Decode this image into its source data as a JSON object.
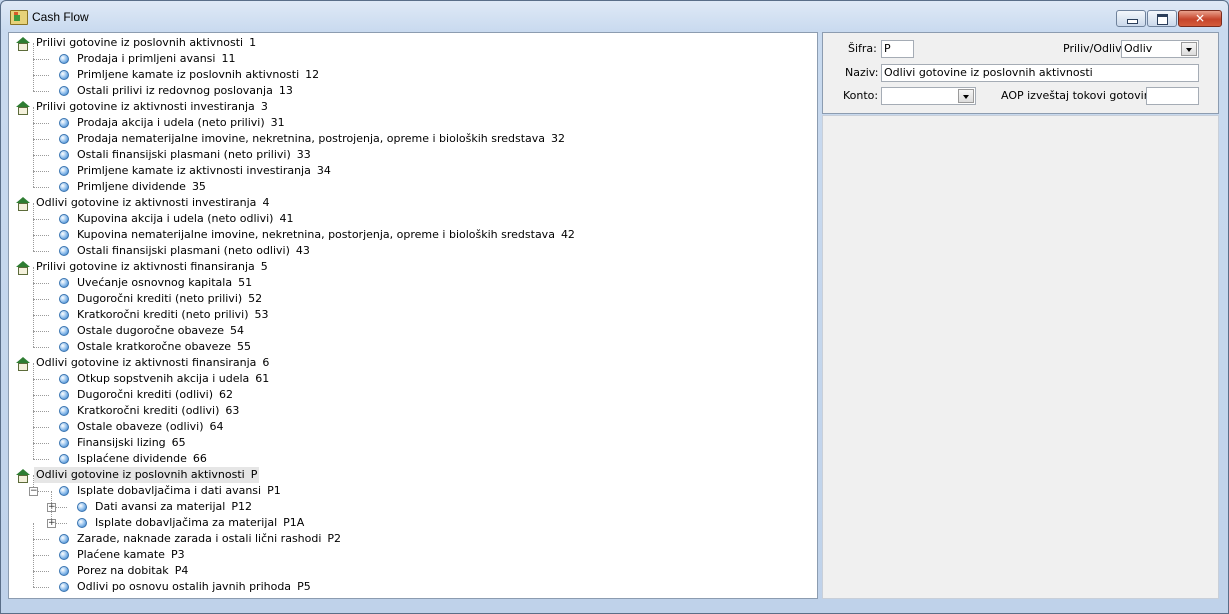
{
  "window": {
    "title": "Cash Flow",
    "controls": {
      "minimize": "minimize",
      "maximize": "maximize",
      "close": "✕"
    }
  },
  "tree": [
    {
      "label": "Prilivi gotovine iz poslovnih aktivnosti",
      "code": "1",
      "level": 0,
      "type": "group"
    },
    {
      "label": "Prodaja i primljeni avansi",
      "code": "11",
      "level": 1,
      "type": "item"
    },
    {
      "label": "Primljene kamate iz poslovnih aktivnosti",
      "code": "12",
      "level": 1,
      "type": "item"
    },
    {
      "label": "Ostali prilivi iz redovnog poslovanja",
      "code": "13",
      "level": 1,
      "type": "item"
    },
    {
      "label": "Prilivi gotovine iz aktivnosti investiranja",
      "code": "3",
      "level": 0,
      "type": "group"
    },
    {
      "label": "Prodaja akcija i udela (neto prilivi)",
      "code": "31",
      "level": 1,
      "type": "item"
    },
    {
      "label": "Prodaja nematerijalne imovine, nekretnina, postrojenja, opreme i bioloških sredstava",
      "code": "32",
      "level": 1,
      "type": "item"
    },
    {
      "label": "Ostali finansijski plasmani (neto prilivi)",
      "code": "33",
      "level": 1,
      "type": "item"
    },
    {
      "label": "Primljene kamate iz aktivnosti investiranja",
      "code": "34",
      "level": 1,
      "type": "item"
    },
    {
      "label": "Primljene dividende",
      "code": "35",
      "level": 1,
      "type": "item"
    },
    {
      "label": "Odlivi gotovine iz aktivnosti investiranja",
      "code": "4",
      "level": 0,
      "type": "group"
    },
    {
      "label": "Kupovina akcija i udela (neto odlivi)",
      "code": "41",
      "level": 1,
      "type": "item"
    },
    {
      "label": "Kupovina nematerijalne imovine, nekretnina, postorjenja, opreme i bioloških sredstava",
      "code": "42",
      "level": 1,
      "type": "item"
    },
    {
      "label": "Ostali finansijski plasmani (neto odlivi)",
      "code": "43",
      "level": 1,
      "type": "item"
    },
    {
      "label": "Prilivi gotovine iz aktivnosti finansiranja",
      "code": "5",
      "level": 0,
      "type": "group"
    },
    {
      "label": "Uvećanje osnovnog kapitala",
      "code": "51",
      "level": 1,
      "type": "item"
    },
    {
      "label": "Dugoročni krediti (neto prilivi)",
      "code": "52",
      "level": 1,
      "type": "item"
    },
    {
      "label": "Kratkoročni krediti (neto prilivi)",
      "code": "53",
      "level": 1,
      "type": "item"
    },
    {
      "label": "Ostale dugoročne obaveze",
      "code": "54",
      "level": 1,
      "type": "item"
    },
    {
      "label": "Ostale kratkoročne obaveze",
      "code": "55",
      "level": 1,
      "type": "item"
    },
    {
      "label": "Odlivi gotovine iz aktivnosti finansiranja",
      "code": "6",
      "level": 0,
      "type": "group"
    },
    {
      "label": "Otkup sopstvenih akcija i udela",
      "code": "61",
      "level": 1,
      "type": "item"
    },
    {
      "label": "Dugoročni krediti (odlivi)",
      "code": "62",
      "level": 1,
      "type": "item"
    },
    {
      "label": "Kratkoročni krediti (odlivi)",
      "code": "63",
      "level": 1,
      "type": "item"
    },
    {
      "label": "Ostale obaveze (odlivi)",
      "code": "64",
      "level": 1,
      "type": "item"
    },
    {
      "label": "Finansijski lizing",
      "code": "65",
      "level": 1,
      "type": "item"
    },
    {
      "label": "Isplaćene dividende",
      "code": "66",
      "level": 1,
      "type": "item"
    },
    {
      "label": "Odlivi gotovine iz poslovnih aktivnosti",
      "code": "P",
      "level": 0,
      "type": "group",
      "selected": true
    },
    {
      "label": "Isplate dobavljačima i dati avansi",
      "code": "P1",
      "level": 1,
      "type": "item",
      "expander": "−"
    },
    {
      "label": "Dati avansi za materijal",
      "code": "P12",
      "level": 2,
      "type": "item",
      "expander": "+"
    },
    {
      "label": "Isplate dobavljačima za materijal",
      "code": "P1A",
      "level": 2,
      "type": "item",
      "expander": "+"
    },
    {
      "label": "Zarade, naknade zarada i ostali lični rashodi",
      "code": "P2",
      "level": 1,
      "type": "item"
    },
    {
      "label": "Plaćene kamate",
      "code": "P3",
      "level": 1,
      "type": "item"
    },
    {
      "label": "Porez na dobitak",
      "code": "P4",
      "level": 1,
      "type": "item"
    },
    {
      "label": "Odlivi po osnovu ostalih javnih prihoda",
      "code": "P5",
      "level": 1,
      "type": "item"
    }
  ],
  "detail": {
    "sifra_label": "Šifra:",
    "sifra_value": "P",
    "priliv_odliv_label": "Priliv/Odliv:",
    "priliv_odliv_value": "Odliv",
    "naziv_label": "Naziv:",
    "naziv_value": "Odlivi gotovine iz poslovnih aktivnosti",
    "konto_label": "Konto:",
    "konto_value": "",
    "aop_label": "AOP izveštaj tokovi gotovine:",
    "aop_value": ""
  }
}
